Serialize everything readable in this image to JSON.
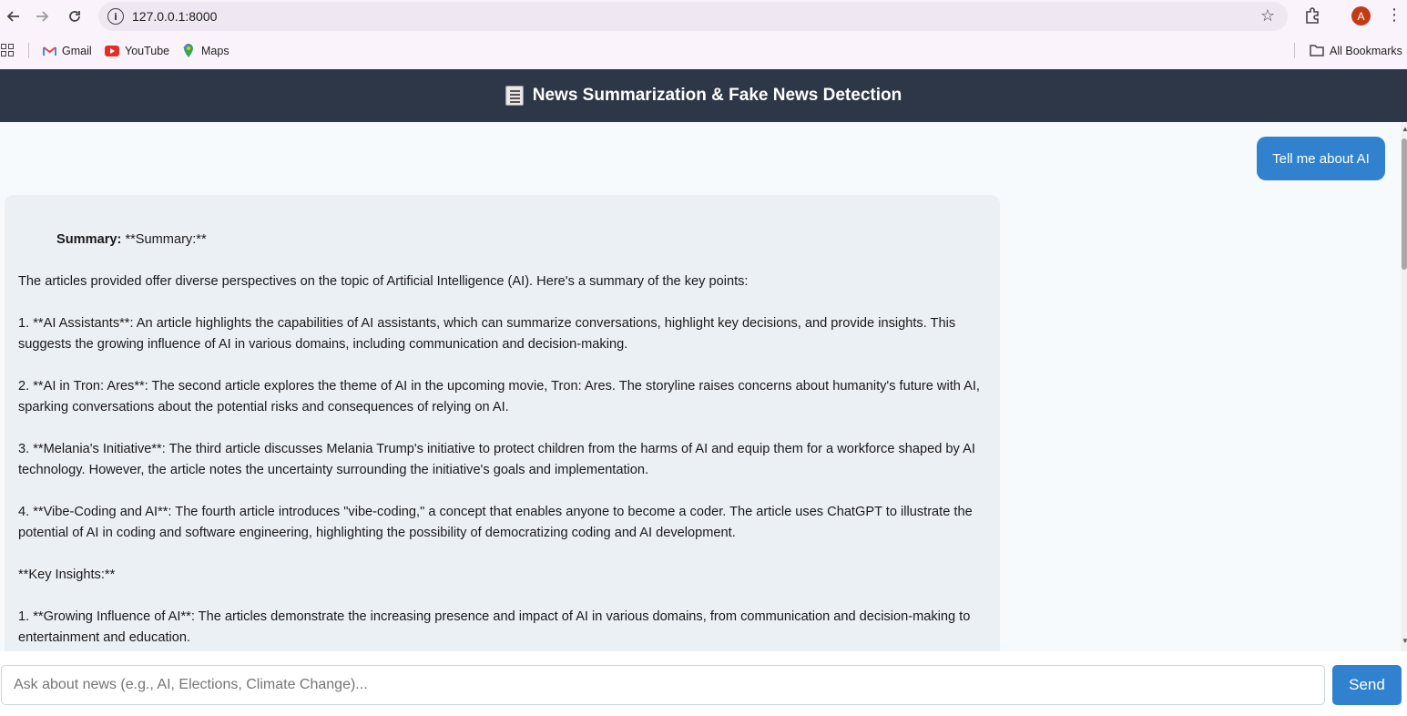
{
  "browser": {
    "url": "127.0.0.1:8000",
    "profile_initial": "A",
    "bookmarks": [
      {
        "label": "Gmail",
        "icon": "gmail-icon"
      },
      {
        "label": "YouTube",
        "icon": "youtube-icon"
      },
      {
        "label": "Maps",
        "icon": "maps-icon"
      }
    ],
    "all_bookmarks_label": "All Bookmarks"
  },
  "app": {
    "title": "News Summarization & Fake News Detection",
    "header_color": "#2d3748",
    "accent_color": "#3182ce"
  },
  "chat": {
    "user_message": "Tell me about AI",
    "bot_message": {
      "summary_label": "Summary:",
      "summary_heading": "**Summary:**",
      "paragraphs": [
        "The articles provided offer diverse perspectives on the topic of Artificial Intelligence (AI). Here's a summary of the key points:",
        "1. **AI Assistants**: An article highlights the capabilities of AI assistants, which can summarize conversations, highlight key decisions, and provide insights. This suggests the growing influence of AI in various domains, including communication and decision-making.",
        "2. **AI in Tron: Ares**: The second article explores the theme of AI in the upcoming movie, Tron: Ares. The storyline raises concerns about humanity's future with AI, sparking conversations about the potential risks and consequences of relying on AI.",
        "3. **Melania's Initiative**: The third article discusses Melania Trump's initiative to protect children from the harms of AI and equip them for a workforce shaped by AI technology. However, the article notes the uncertainty surrounding the initiative's goals and implementation.",
        "4. **Vibe-Coding and AI**: The fourth article introduces \"vibe-coding,\" a concept that enables anyone to become a coder. The article uses ChatGPT to illustrate the potential of AI in coding and software engineering, highlighting the possibility of democratizing coding and AI development.",
        "**Key Insights:**",
        "1. **Growing Influence of AI**: The articles demonstrate the increasing presence and impact of AI in various domains, from communication and decision-making to entertainment and education."
      ]
    }
  },
  "composer": {
    "placeholder": "Ask about news (e.g., AI, Elections, Climate Change)...",
    "value": "",
    "send_label": "Send"
  }
}
